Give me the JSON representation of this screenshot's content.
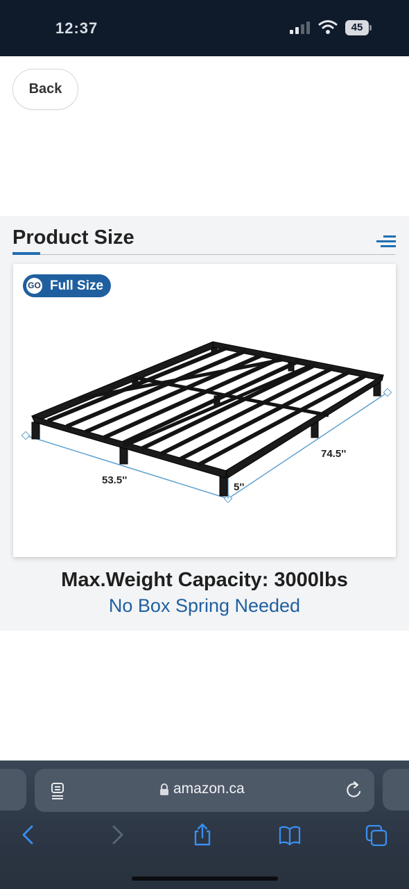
{
  "status_bar": {
    "time": "12:37",
    "battery": "45"
  },
  "back_button": {
    "label": "Back"
  },
  "product_section": {
    "title": "Product Size",
    "badge": {
      "logo": "GO",
      "label": "Full Size"
    },
    "dimensions": {
      "width": "53.5''",
      "length": "74.5''",
      "height": "5''"
    },
    "weight_capacity": "Max.Weight Capacity: 3000lbs",
    "box_spring_note": "No Box Spring Needed",
    "accent_color": "#1f5f9f"
  },
  "browser": {
    "url": "amazon.ca",
    "icons": [
      "reader-icon",
      "lock-icon",
      "reload-icon",
      "back-arrow-icon",
      "forward-arrow-icon",
      "share-icon",
      "bookmarks-icon",
      "tabs-icon"
    ]
  }
}
